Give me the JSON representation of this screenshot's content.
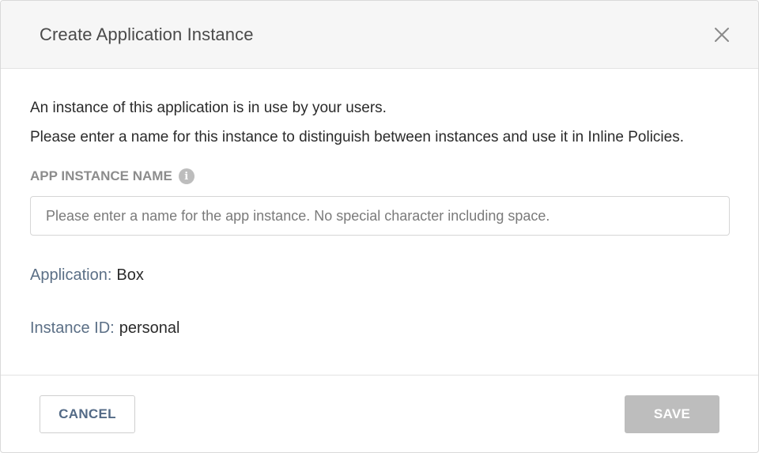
{
  "dialog": {
    "title": "Create Application Instance",
    "close_icon": "close-icon"
  },
  "description": {
    "line1": "An instance of this application is in use by your users.",
    "line2": "Please enter a name for this instance to distinguish between instances and use it in Inline Policies."
  },
  "instance_name_field": {
    "label": "APP INSTANCE NAME",
    "info_icon": "info-icon",
    "info_glyph": "i",
    "value": "",
    "placeholder": "Please enter a name for the app instance. No special character including space."
  },
  "details": {
    "application_label": "Application:",
    "application_value": "Box",
    "instance_id_label": "Instance ID:",
    "instance_id_value": "personal"
  },
  "footer": {
    "cancel_label": "CANCEL",
    "save_label": "SAVE"
  },
  "colors": {
    "header_bg": "#f6f6f6",
    "key_text": "#5b6f86",
    "save_disabled_bg": "#bdbdbd",
    "cancel_text": "#536a86"
  }
}
